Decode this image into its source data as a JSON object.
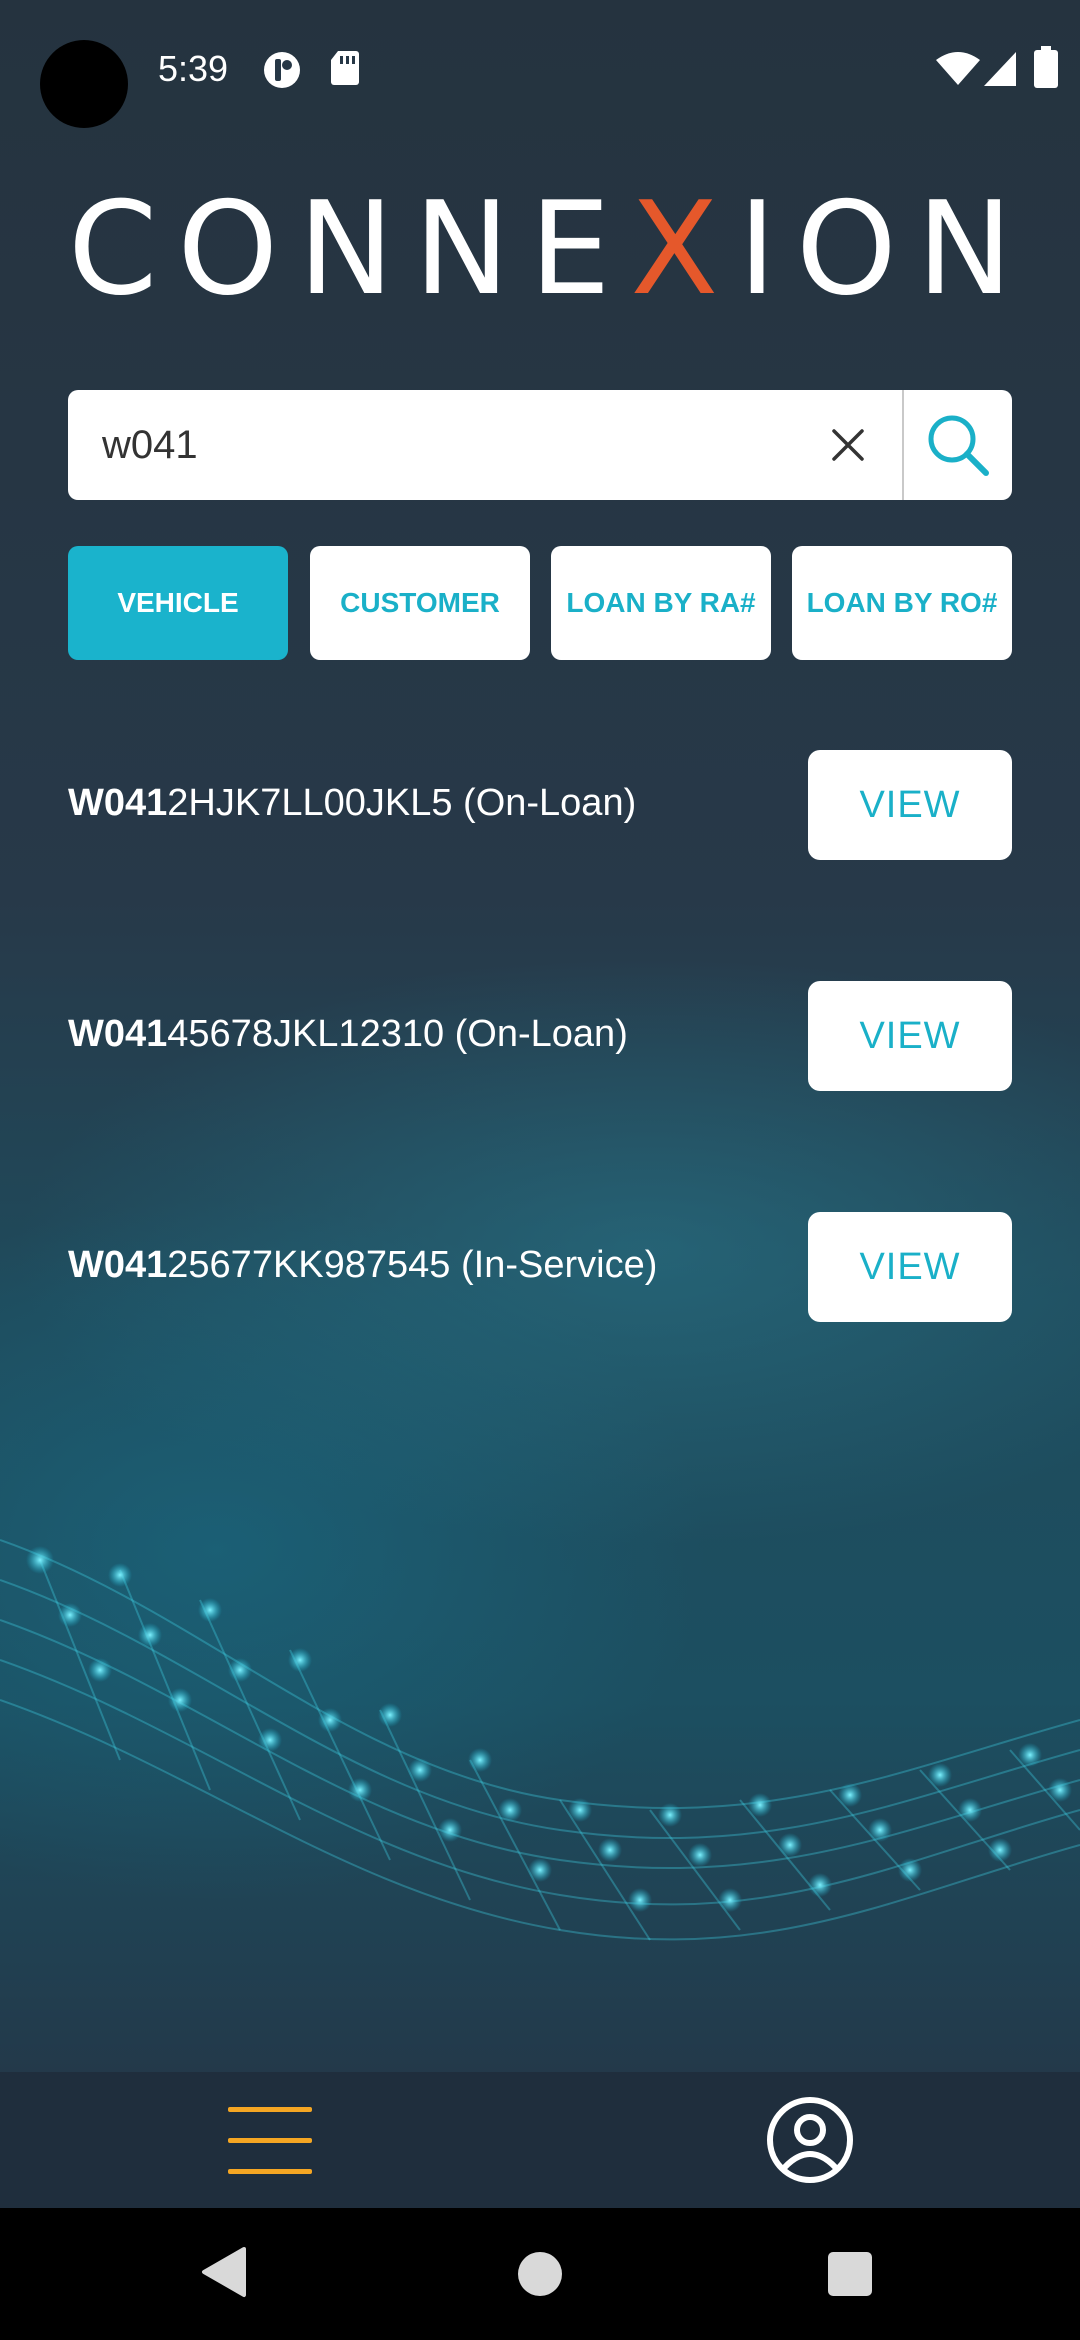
{
  "status_bar": {
    "time": "5:39",
    "left_icons": [
      "app-notification-icon",
      "sd-card-icon"
    ],
    "right_icons": [
      "wifi-icon",
      "cell-signal-icon",
      "battery-icon"
    ]
  },
  "logo": {
    "before": "CONNE",
    "accent": "X",
    "after": "ION",
    "accent_color": "#e5582b"
  },
  "search": {
    "value": "w041",
    "clear_icon": "close-icon",
    "search_icon": "search-icon"
  },
  "tabs": [
    {
      "label": "VEHICLE",
      "active": true
    },
    {
      "label": "CUSTOMER",
      "active": false
    },
    {
      "label": "LOAN BY RA#",
      "active": false
    },
    {
      "label": "LOAN BY RO#",
      "active": false
    }
  ],
  "results": [
    {
      "match": "W041",
      "rest": "2HJK7LL00JKL5 (On-Loan)",
      "button": "VIEW"
    },
    {
      "match": "W041",
      "rest": "45678JKL12310 (On-Loan)",
      "button": "VIEW"
    },
    {
      "match": "W041",
      "rest": "25677KK987545 (In-Service)",
      "button": "VIEW"
    }
  ],
  "bottom_bar": {
    "menu_icon": "hamburger-menu-icon",
    "profile_icon": "user-profile-icon"
  },
  "colors": {
    "accent": "#1ab3cc",
    "background": "#263746",
    "menu_icon": "#f5a623"
  }
}
